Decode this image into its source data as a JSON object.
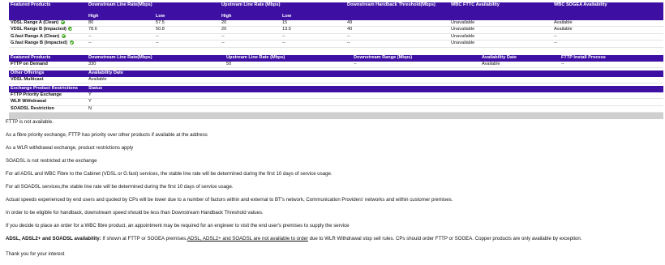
{
  "products": {
    "headers": {
      "product": "Featured Products",
      "downstream": "Downstream Line Rate(Mbps)",
      "upstream": "Upstream Line Rate (Mbps)",
      "handback": "Downstream Handback Threshold(Mbps)",
      "fttc": "WBC FTTC Availability",
      "sogea": "WBC SOGEA Availability"
    },
    "subheaders": {
      "high": "High",
      "low": "Low"
    },
    "rows": [
      {
        "name": "VDSL Range A (Clean)",
        "tick": true,
        "down_high": "80",
        "down_low": "57.5",
        "up_high": "20",
        "up_low": "15",
        "handback": "49",
        "fttc": "Unavailable",
        "sogea": "Available"
      },
      {
        "name": "VDSL Range B (Impacted)",
        "tick": true,
        "down_high": "78.6",
        "down_low": "50.8",
        "up_high": "20",
        "up_low": "13.5",
        "handback": "40",
        "fttc": "Unavailable",
        "sogea": "Available"
      },
      {
        "name": "G.fast Range A (Clean)",
        "tick": true,
        "down_high": "--",
        "down_low": "--",
        "up_high": "--",
        "up_low": "--",
        "handback": "--",
        "fttc": "Unavailable",
        "sogea": "--"
      },
      {
        "name": "G.fast Range B (Impacted)",
        "tick": true,
        "down_high": "--",
        "down_low": "--",
        "up_high": "--",
        "up_low": "--",
        "handback": "--",
        "fttc": "Unavailable",
        "sogea": "--"
      }
    ]
  },
  "fttp": {
    "headers": {
      "product": "Featured Products",
      "downstream": "Downstream Line Rate(Mbps)",
      "upstream": "Upstream Line Rate (Mbps)",
      "range": "Downstream Range (Mbps)",
      "date": "Availability Date",
      "process": "FTTP Install Process"
    },
    "row": {
      "name": "FTTP on Demand",
      "downstream": "330",
      "upstream": "50",
      "range": "--",
      "date": "Available",
      "process": "--"
    }
  },
  "other": {
    "headers": {
      "name": "Other Offerings",
      "date": "Availability Date"
    },
    "row": {
      "name": "VDSL Multicast",
      "date": "Available"
    }
  },
  "restrictions": {
    "headers": {
      "name": "Exchange Product Restrictions",
      "status": "Status"
    },
    "rows": [
      {
        "name": "FTTP Priority Exchange",
        "status": "Y"
      },
      {
        "name": "WLR Withdrawal",
        "status": "Y"
      },
      {
        "name": "SOADSL Restriction",
        "status": "N"
      }
    ]
  },
  "notes": {
    "n1": "FTTP is not available.",
    "n2": "As a fibre priority exchange, FTTP has priority over other products if available at the address",
    "n3": "As a WLR withdrawal exchange, product restrictions apply",
    "n4": "SOADSL is not restricted at the exchange",
    "n5": "For all ADSL and WBC Fibre to the Cabinet (VDSL or G.fast) services, the stable line rate will be determined during the first 10 days of service usage.",
    "n6": "For all SOADSL services,the stable line rate will be determined during the first 10 days of service usage.",
    "n7": "Actual speeds experienced by end users and quoted by CPs will be lower due to a number of factors within and external to BT's network, Communication Providers' networks and within customer premises.",
    "n8": "In order to be eligible for handback, downstream speed should be less than Downstream Handback Threshold values.",
    "n9": "If you decide to place an order for a WBC fibre product, an appointment may be required for an engineer to visit the end user's premises to supply the service",
    "n10_bold": "ADSL, ADSL2+ and SOADSL availability:",
    "n10_a": " If shown at FTTP or SOGEA premises,",
    "n10_u": "ADSL, ADSL2+ and SOADSL are not available to order",
    "n10_b": " due to WLR Withdrawal stop sell rules. CPs should order FTTP or SOGEA. Copper products are only available by exception.",
    "n11": "Thank you for your interest"
  }
}
